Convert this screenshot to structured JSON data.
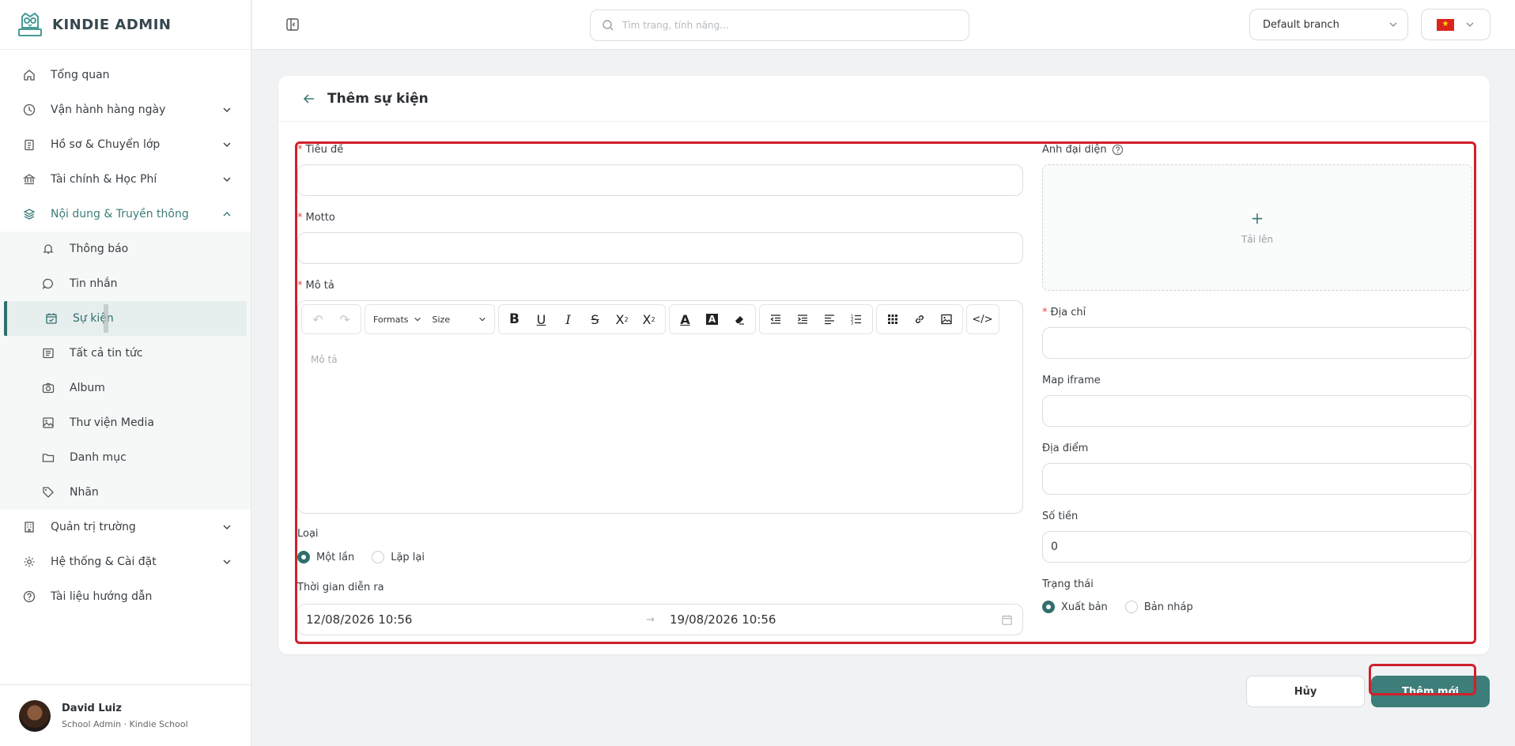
{
  "brand": {
    "name": "KINDIE ADMIN"
  },
  "topbar": {
    "search_placeholder": "Tìm trang, tính năng...",
    "branch": "Default branch"
  },
  "sidebar": {
    "items": [
      {
        "label": "Tổng quan",
        "icon": "home-icon"
      },
      {
        "label": "Vận hành hàng ngày",
        "icon": "clock-icon"
      },
      {
        "label": "Hồ sơ & Chuyển lớp",
        "icon": "clipboard-icon"
      },
      {
        "label": "Tài chính & Học Phí",
        "icon": "bank-icon"
      },
      {
        "label": "Nội dung & Truyền thông",
        "icon": "layers-icon"
      },
      {
        "label": "Quản trị trường",
        "icon": "building-icon"
      },
      {
        "label": "Hệ thống & Cài đặt",
        "icon": "gear-icon"
      },
      {
        "label": "Tài liệu hướng dẫn",
        "icon": "help-circle-icon"
      }
    ],
    "sub_items": [
      {
        "label": "Thông báo",
        "icon": "bell-icon"
      },
      {
        "label": "Tin nhắn",
        "icon": "chat-icon"
      },
      {
        "label": "Sự kiện",
        "icon": "calendar-check-icon"
      },
      {
        "label": "Tất cả tin tức",
        "icon": "newspaper-icon"
      },
      {
        "label": "Album",
        "icon": "camera-icon"
      },
      {
        "label": "Thư viện Media",
        "icon": "image-icon"
      },
      {
        "label": "Danh mục",
        "icon": "folder-icon"
      },
      {
        "label": "Nhãn",
        "icon": "tag-icon"
      }
    ]
  },
  "profile": {
    "name": "David Luiz",
    "role": "School Admin · Kindie School"
  },
  "page": {
    "title": "Thêm sự kiện"
  },
  "form": {
    "title_label": "Tiêu đề",
    "motto_label": "Motto",
    "description_label": "Mô tả",
    "description_placeholder": "Mô tả",
    "toolbar": {
      "formats": "Formats",
      "size": "Size"
    },
    "type_label": "Loại",
    "type_options": [
      "Một lần",
      "Lặp lại"
    ],
    "time_label": "Thời gian diễn ra",
    "start_time": "12/08/2026 10:56",
    "end_time": "19/08/2026 10:56",
    "image_label": "Ảnh đại diện",
    "upload_text": "Tải lên",
    "address_label": "Địa chỉ",
    "map_label": "Map iframe",
    "location_label": "Địa điểm",
    "amount_label": "Số tiền",
    "amount_value": "0",
    "status_label": "Trạng thái",
    "status_options": [
      "Xuất bản",
      "Bản nháp"
    ]
  },
  "actions": {
    "cancel": "Hủy",
    "submit": "Thêm mới"
  },
  "colors": {
    "primary": "#3d7d7a",
    "highlight": "#d0202a",
    "required": "#e5484d"
  }
}
